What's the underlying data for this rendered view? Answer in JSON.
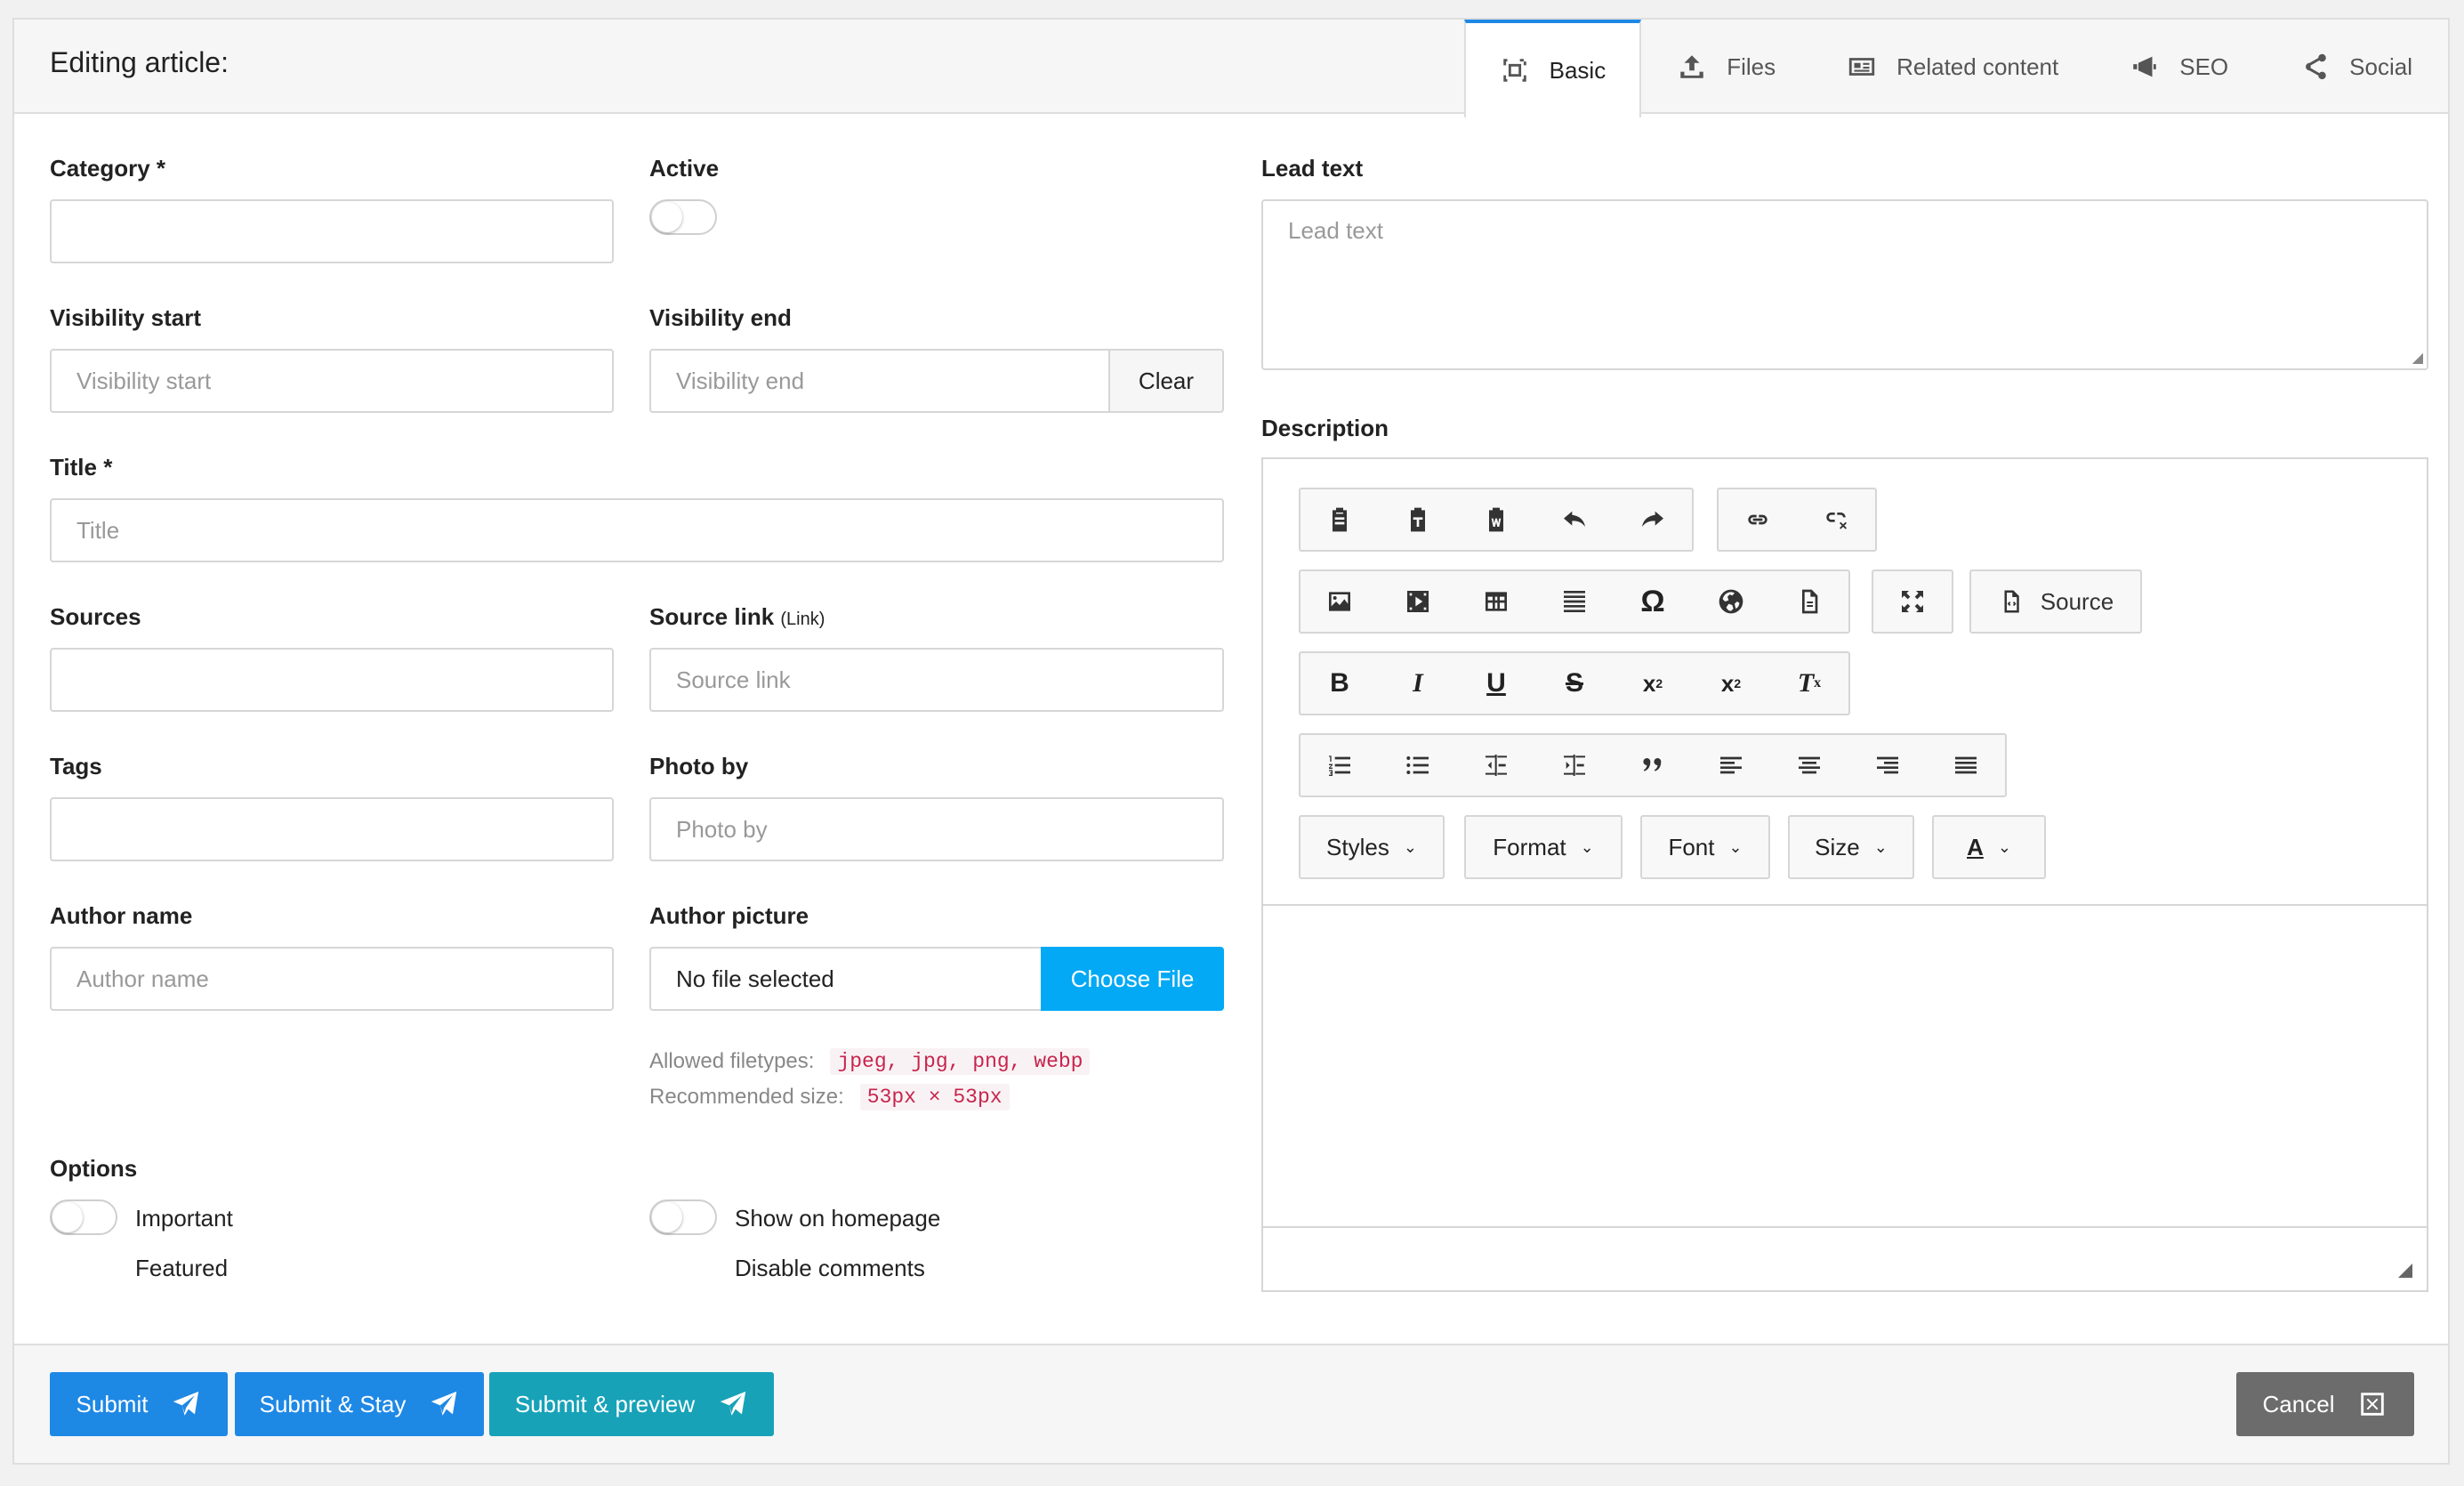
{
  "header": {
    "title": "Editing article:"
  },
  "tabs": [
    {
      "label": "Basic",
      "icon": "basic-frame-icon",
      "active": true
    },
    {
      "label": "Files",
      "icon": "upload-icon"
    },
    {
      "label": "Related content",
      "icon": "news-icon"
    },
    {
      "label": "SEO",
      "icon": "megaphone-icon"
    },
    {
      "label": "Social",
      "icon": "share-icon"
    }
  ],
  "form": {
    "category": {
      "label": "Category *",
      "value": ""
    },
    "active": {
      "label": "Active",
      "checked": false
    },
    "visibility_start": {
      "label": "Visibility start",
      "placeholder": "Visibility start"
    },
    "visibility_end": {
      "label": "Visibility end",
      "placeholder": "Visibility end",
      "clear_label": "Clear"
    },
    "title": {
      "label": "Title *",
      "placeholder": "Title"
    },
    "sources": {
      "label": "Sources",
      "value": ""
    },
    "source_link": {
      "label": "Source link",
      "label_small": "(Link)",
      "placeholder": "Source link"
    },
    "tags": {
      "label": "Tags",
      "value": ""
    },
    "photo_by": {
      "label": "Photo by",
      "placeholder": "Photo by"
    },
    "author_name": {
      "label": "Author name",
      "placeholder": "Author name"
    },
    "author_picture": {
      "label": "Author picture",
      "file_status": "No file selected",
      "choose_label": "Choose File",
      "allowed_label": "Allowed filetypes:",
      "allowed_value": "jpeg, jpg, png, webp",
      "recommended_label": "Recommended size:",
      "recommended_value": "53px × 53px"
    },
    "options": {
      "label": "Options",
      "important": "Important",
      "featured": "Featured",
      "show_on_homepage": "Show on homepage",
      "disable_comments": "Disable comments"
    },
    "lead_text": {
      "label": "Lead text",
      "placeholder": "Lead text"
    },
    "description": {
      "label": "Description",
      "source_label": "Source",
      "styles_label": "Styles",
      "format_label": "Format",
      "font_label": "Font",
      "size_label": "Size",
      "color_glyph": "A"
    }
  },
  "footer": {
    "submit": "Submit",
    "submit_stay": "Submit & Stay",
    "submit_preview": "Submit & preview",
    "cancel": "Cancel"
  },
  "colors": {
    "primary": "#1e88e5",
    "teal": "#17a2b8",
    "file_button": "#03a9f4",
    "cancel": "#6c6c6c",
    "code_text": "#c7254e"
  }
}
